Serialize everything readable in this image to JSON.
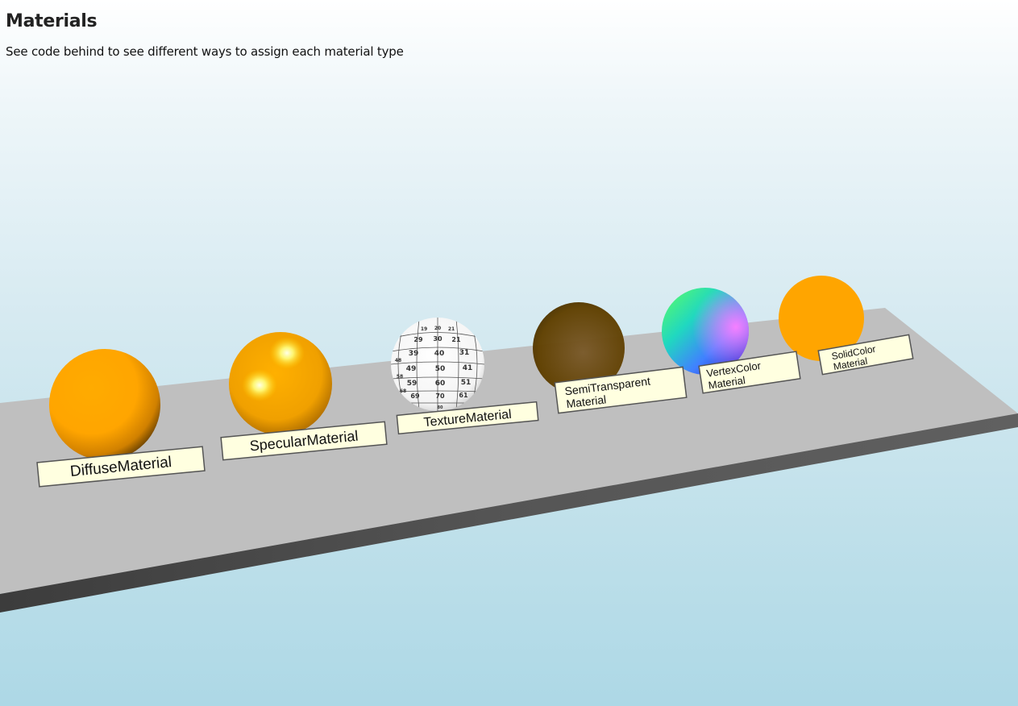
{
  "page": {
    "title": "Materials",
    "subtitle": "See code behind to see different ways to assign each material type"
  },
  "scene": {
    "labels": {
      "diffuse": "DiffuseMaterial",
      "specular": "SpecularMaterial",
      "texture": "TextureMaterial",
      "semitransparent_line1": "SemiTransparent",
      "semitransparent_line2": "Material",
      "vertexcolor_line1": "VertexColor",
      "vertexcolor_line2": "Material",
      "solidcolor_line1": "SolidColor",
      "solidcolor_line2": "Material"
    },
    "texture_numbers": [
      "19",
      "20",
      "21",
      "29",
      "30",
      "21",
      "39",
      "40",
      "31",
      "49",
      "50",
      "41",
      "59",
      "60",
      "51",
      "69",
      "70",
      "61",
      "80",
      "48",
      "58",
      "68"
    ],
    "colors": {
      "material_orange": "#FFA500",
      "semitransparent_brown": "#5a3a00",
      "label_fill": "#FFFFE0",
      "plane_top": "#BFBFBF",
      "plane_edge": "#555555"
    }
  }
}
